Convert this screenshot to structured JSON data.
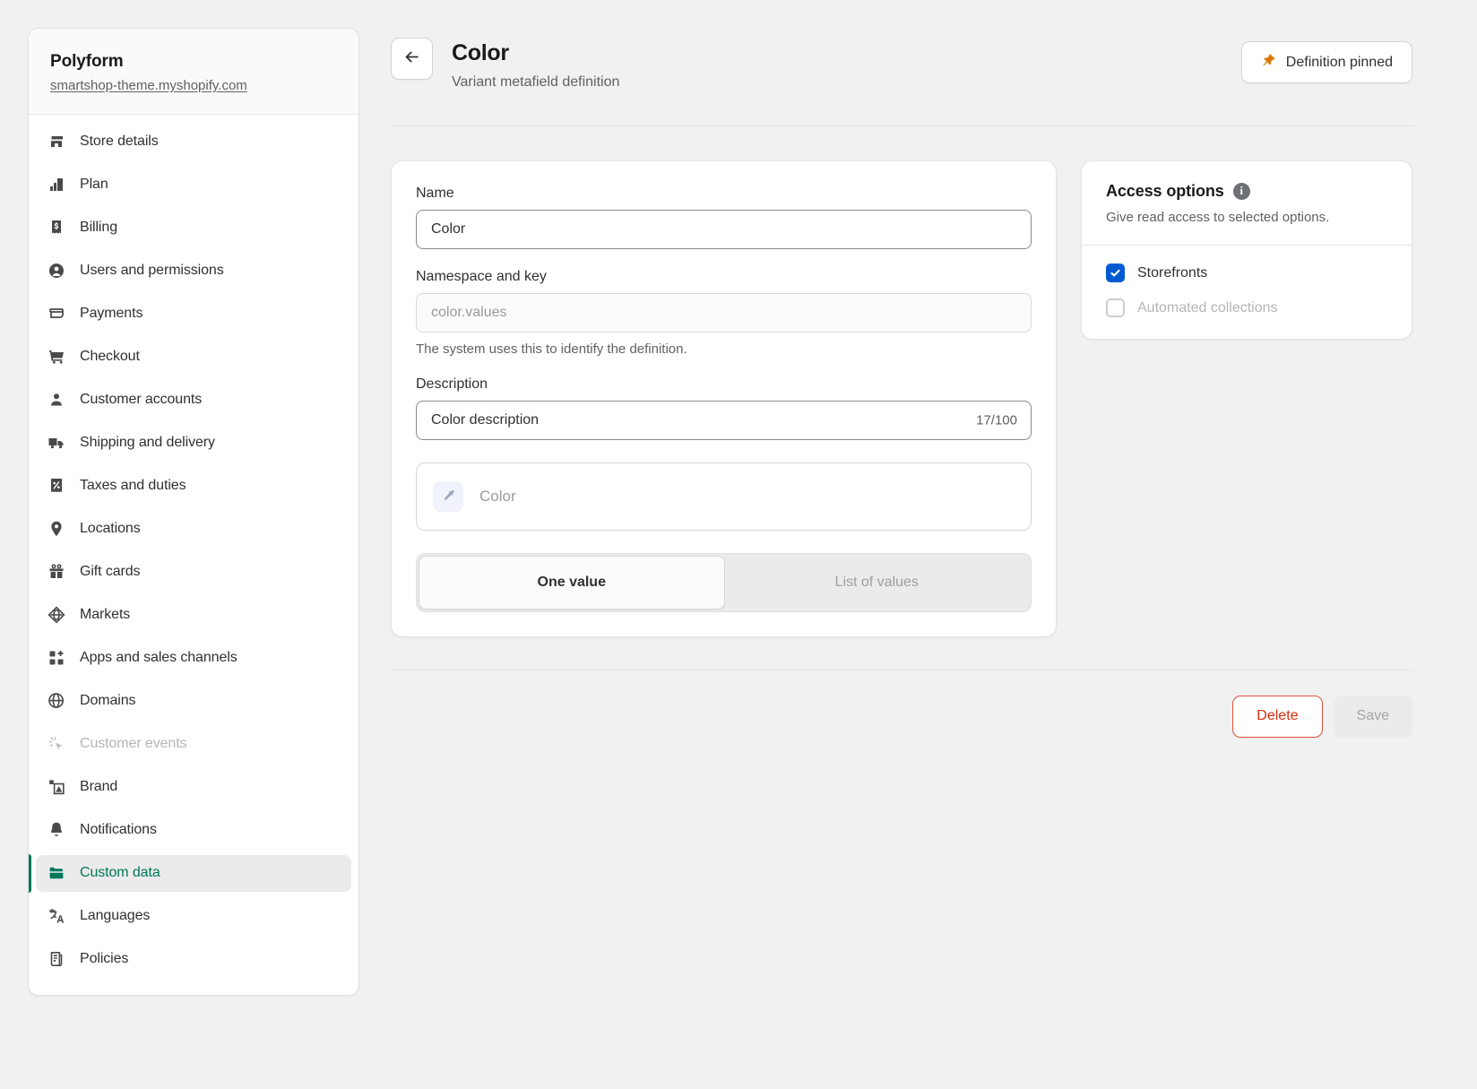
{
  "sidebar": {
    "shop_name": "Polyform",
    "shop_url": "smartshop-theme.myshopify.com",
    "items": [
      {
        "label": "Store details",
        "icon": "store-icon",
        "state": "default"
      },
      {
        "label": "Plan",
        "icon": "plan-icon",
        "state": "default"
      },
      {
        "label": "Billing",
        "icon": "billing-icon",
        "state": "default"
      },
      {
        "label": "Users and permissions",
        "icon": "users-icon",
        "state": "default"
      },
      {
        "label": "Payments",
        "icon": "payments-icon",
        "state": "default"
      },
      {
        "label": "Checkout",
        "icon": "checkout-cart-icon",
        "state": "default"
      },
      {
        "label": "Customer accounts",
        "icon": "customer-accounts-icon",
        "state": "default"
      },
      {
        "label": "Shipping and delivery",
        "icon": "shipping-truck-icon",
        "state": "default"
      },
      {
        "label": "Taxes and duties",
        "icon": "taxes-percent-icon",
        "state": "default"
      },
      {
        "label": "Locations",
        "icon": "location-pin-icon",
        "state": "default"
      },
      {
        "label": "Gift cards",
        "icon": "gift-card-icon",
        "state": "default"
      },
      {
        "label": "Markets",
        "icon": "markets-globe-icon",
        "state": "default"
      },
      {
        "label": "Apps and sales channels",
        "icon": "apps-plus-icon",
        "state": "default"
      },
      {
        "label": "Domains",
        "icon": "domains-globe-icon",
        "state": "default"
      },
      {
        "label": "Customer events",
        "icon": "customer-events-cursor-icon",
        "state": "disabled"
      },
      {
        "label": "Brand",
        "icon": "brand-image-icon",
        "state": "default"
      },
      {
        "label": "Notifications",
        "icon": "notifications-bell-icon",
        "state": "default"
      },
      {
        "label": "Custom data",
        "icon": "custom-data-icon",
        "state": "active"
      },
      {
        "label": "Languages",
        "icon": "languages-icon",
        "state": "default"
      },
      {
        "label": "Policies",
        "icon": "policies-icon",
        "state": "default"
      }
    ]
  },
  "header": {
    "title": "Color",
    "subtitle": "Variant metafield definition",
    "back_icon": "back-arrow-icon",
    "pinned_button": {
      "label": "Definition pinned",
      "icon": "pin-icon",
      "icon_color": "#d97b06"
    }
  },
  "form": {
    "name": {
      "label": "Name",
      "value": "Color"
    },
    "namespace": {
      "label": "Namespace and key",
      "value": "color.values",
      "help": "The system uses this to identify the definition."
    },
    "description": {
      "label": "Description",
      "value": "Color description",
      "counter": "17/100"
    },
    "color_picker": {
      "label": "Color",
      "icon": "eyedropper-icon"
    },
    "value_type": {
      "options": [
        {
          "label": "One value",
          "selected": true
        },
        {
          "label": "List of values",
          "selected": false
        }
      ]
    }
  },
  "access_options": {
    "title": "Access options",
    "info_icon": "info-icon",
    "subtitle": "Give read access to selected options.",
    "checkboxes": [
      {
        "label": "Storefronts",
        "checked": true,
        "disabled": false
      },
      {
        "label": "Automated collections",
        "checked": false,
        "disabled": true
      }
    ],
    "checked_color": "#005bd3"
  },
  "footer": {
    "delete_label": "Delete",
    "save_label": "Save",
    "delete_color": "#d72c0d"
  }
}
